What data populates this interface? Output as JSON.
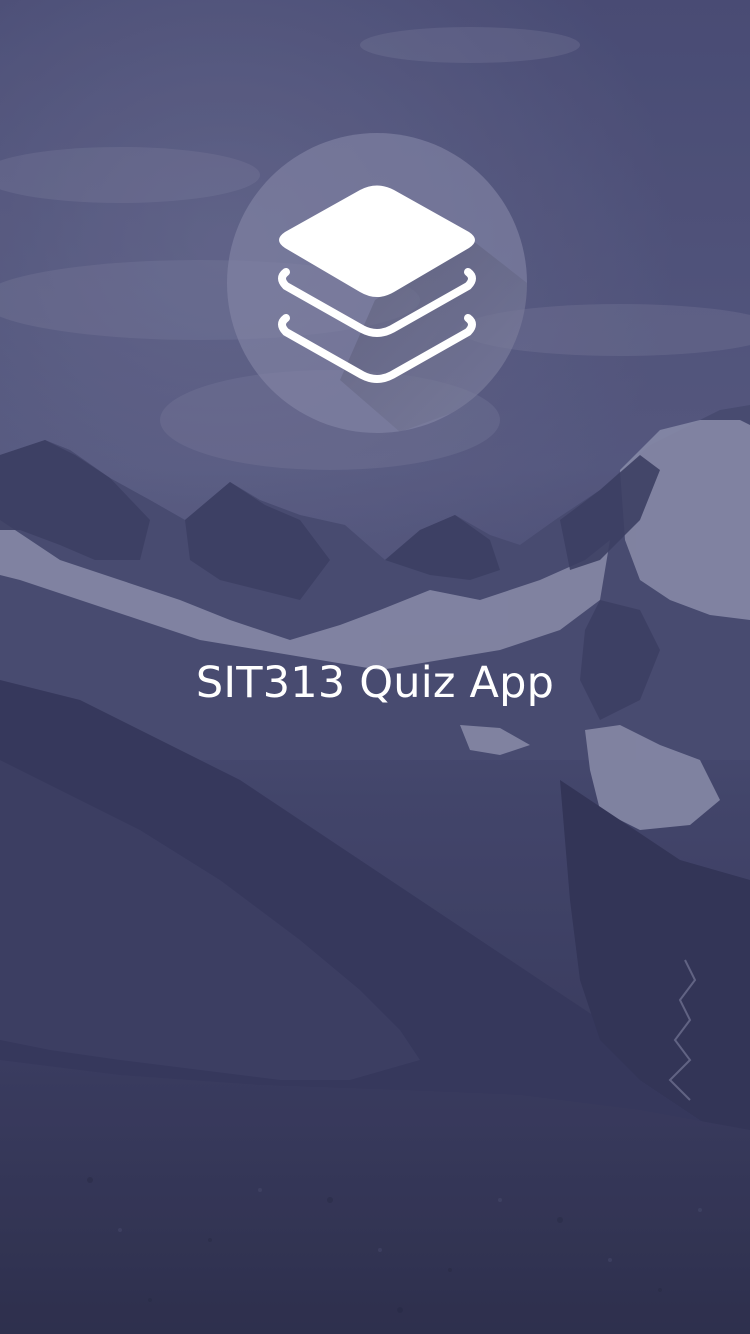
{
  "splash": {
    "app_title": "SIT313 Quiz App",
    "logo_icon": "layers-stack-icon",
    "background": "mountain-landscape-image"
  },
  "colors": {
    "overlay_tint": "#414268",
    "sky_top": "#4e5078",
    "ground": "#2e2f4c",
    "snow": "#a7a9c2",
    "logo_circle": "#8385a6",
    "foreground": "#ffffff"
  }
}
